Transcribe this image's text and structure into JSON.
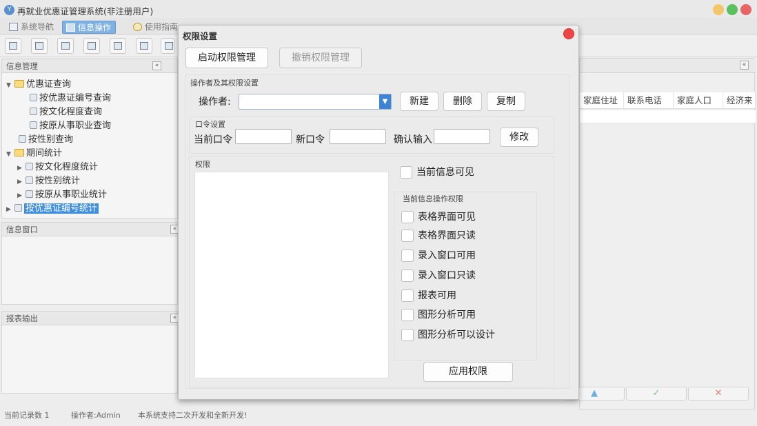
{
  "window": {
    "title": "再就业优惠证管理系统(非注册用户)",
    "logo": "app-logo-icon"
  },
  "menu_tabs": [
    {
      "label": "系统导航",
      "icon": "nav-icon"
    },
    {
      "label": "信息操作",
      "icon": "grid-icon"
    },
    {
      "label": "使用指南",
      "icon": "compass-icon"
    }
  ],
  "panels": {
    "info_mgmt": {
      "title": "信息管理"
    },
    "info_window": {
      "title": "信息窗口"
    },
    "report_output": {
      "title": "报表输出"
    }
  },
  "tree": [
    {
      "label": "优惠证查询"
    },
    {
      "label": "按优惠证编号查询"
    },
    {
      "label": "按文化程度查询"
    },
    {
      "label": "按原从事职业查询"
    },
    {
      "label": "按性别查询"
    },
    {
      "label": "期间统计"
    },
    {
      "label": "按文化程度统计"
    },
    {
      "label": "按性别统计"
    },
    {
      "label": "按原从事职业统计"
    },
    {
      "label": "按优惠证编号统计"
    }
  ],
  "grid": {
    "columns": [
      "家庭住址",
      "联系电话",
      "家庭人口",
      "经济来"
    ]
  },
  "status": {
    "records": "当前记录数 1",
    "operator": "操作者:Admin",
    "message": "本系统支持二次开发和全新开发!"
  },
  "dialog": {
    "title": "权限设置",
    "enable_btn": "启动权限管理",
    "revoke_btn": "撤销权限管理",
    "operator_group": "操作者及其权限设置",
    "operator_label": "操作者:",
    "operator_value": "",
    "new_btn": "新建",
    "delete_btn": "删除",
    "copy_btn": "复制",
    "password_group": "口令设置",
    "current_pw_label": "当前口令",
    "new_pw_label": "新口令",
    "confirm_label": "确认输入",
    "modify_btn": "修改",
    "permissions_group": "权限",
    "visible_label": "当前信息可见",
    "ops_group": "当前信息操作权限",
    "ops": [
      "表格界面可见",
      "表格界面只读",
      "录入窗口可用",
      "录入窗口只读",
      "报表可用",
      "图形分析可用",
      "图形分析可以设计"
    ],
    "apply_btn": "应用权限"
  }
}
